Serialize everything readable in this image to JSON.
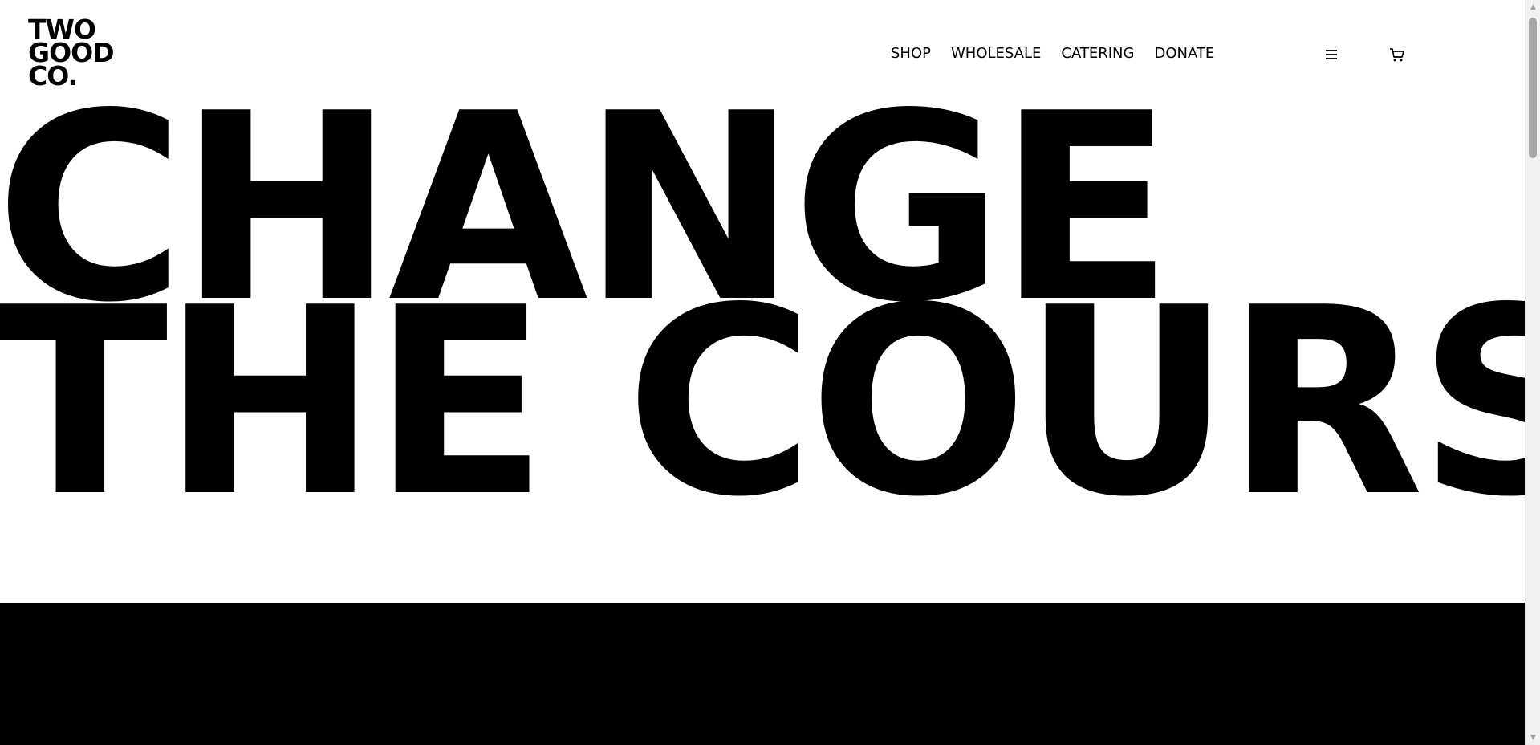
{
  "logo": {
    "line1": "TWO",
    "line2": "GOOD",
    "line3": "CO."
  },
  "nav": {
    "items": [
      {
        "label": "SHOP"
      },
      {
        "label": "WHOLESALE"
      },
      {
        "label": "CATERING"
      },
      {
        "label": "DONATE"
      }
    ]
  },
  "icons": {
    "menu": "menu-icon",
    "cart": "cart-icon"
  },
  "hero": {
    "line1": "CHANGE",
    "line2": "THE COURSE"
  },
  "colors": {
    "background": "#ffffff",
    "text": "#000000",
    "band": "#000000"
  },
  "scrollbar": {
    "up_glyph": "▲",
    "down_glyph": "▼"
  }
}
